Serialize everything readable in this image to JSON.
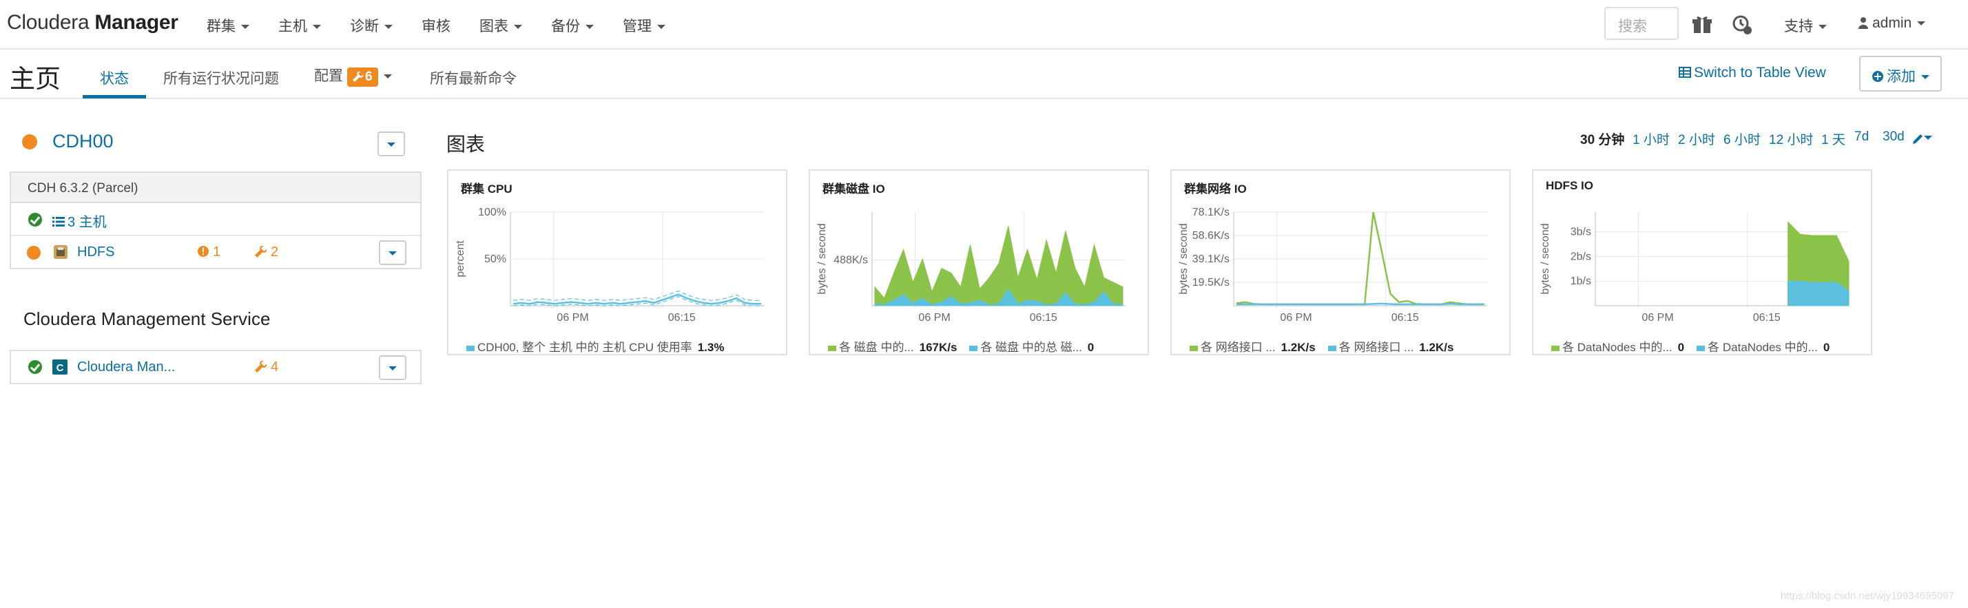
{
  "header": {
    "brand_light": "Cloudera ",
    "brand_bold": "Manager",
    "menu": [
      "群集",
      "主机",
      "诊断",
      "审核",
      "图表",
      "备份",
      "管理"
    ],
    "menu_has_caret": [
      true,
      true,
      true,
      false,
      true,
      true,
      true
    ],
    "search_placeholder": "搜索",
    "support_label": "支持",
    "user_label": "admin"
  },
  "subheader": {
    "page_title": "主页",
    "tabs": [
      "状态",
      "所有运行状况问题",
      "配置",
      "所有最新命令"
    ],
    "active_tab": 0,
    "config_badge": "6",
    "switch_view_label": "Switch to Table View",
    "add_label": "添加"
  },
  "cluster": {
    "name": "CDH00",
    "status_color": "#f0891f",
    "version": "CDH 6.3.2 (Parcel)",
    "hosts_label": "3 主机",
    "service_name": "HDFS",
    "service_alerts": "1",
    "service_config_issues": "2"
  },
  "cms": {
    "section_title": "Cloudera Management Service",
    "service_name": "Cloudera Man...",
    "config_issues": "4"
  },
  "charts_section": {
    "title": "图表",
    "time_ranges": [
      "30 分钟",
      "1 小时",
      "2 小时",
      "6 小时",
      "12 小时",
      "1 天",
      "7d",
      "30d"
    ],
    "active_range": 0
  },
  "chart_data": [
    {
      "type": "line",
      "title": "群集 CPU",
      "ylabel": "percent",
      "y_ticks": [
        "100%",
        "50%"
      ],
      "x_ticks": [
        "06 PM",
        "06:15"
      ],
      "ylim": [
        0,
        100
      ],
      "series": [
        {
          "name": "CDH00, 整个 主机 中的 主机 CPU 使用率",
          "color": "#5bc0de",
          "values": [
            2,
            3,
            2,
            4,
            3,
            2,
            3,
            4,
            3,
            2,
            3,
            2,
            3,
            2,
            3,
            4,
            5,
            3,
            6,
            9,
            12,
            8,
            5,
            3,
            2,
            3,
            5,
            8,
            3,
            2,
            2
          ]
        }
      ],
      "legend_values": [
        "1.3%"
      ]
    },
    {
      "type": "area",
      "title": "群集磁盘 IO",
      "ylabel": "bytes / second",
      "y_ticks": [
        "488K/s"
      ],
      "x_ticks": [
        "06 PM",
        "06:15"
      ],
      "ylim": [
        0,
        1000000
      ],
      "series": [
        {
          "name": "各 磁盘 中的...",
          "color": "#8bc34a",
          "values": [
            200000,
            80000,
            350000,
            600000,
            250000,
            500000,
            150000,
            400000,
            350000,
            200000,
            650000,
            180000,
            300000,
            450000,
            850000,
            300000,
            600000,
            280000,
            700000,
            350000,
            800000,
            400000,
            200000,
            650000,
            300000,
            250000,
            200000
          ]
        },
        {
          "name": "各 磁盘 中的总 磁...",
          "color": "#5bc0de",
          "values": [
            20000,
            10000,
            60000,
            120000,
            30000,
            80000,
            10000,
            40000,
            100000,
            20000,
            30000,
            60000,
            10000,
            20000,
            180000,
            20000,
            60000,
            50000,
            10000,
            20000,
            140000,
            20000,
            10000,
            40000,
            150000,
            20000,
            10000
          ]
        }
      ],
      "legend_values": [
        "167K/s",
        "0"
      ]
    },
    {
      "type": "line",
      "title": "群集网络 IO",
      "ylabel": "bytes / second",
      "y_ticks": [
        "78.1K/s",
        "58.6K/s",
        "39.1K/s",
        "19.5K/s"
      ],
      "x_ticks": [
        "06 PM",
        "06:15"
      ],
      "ylim": [
        0,
        78100
      ],
      "series": [
        {
          "name": "各 网络接口 ...",
          "color": "#8bc34a",
          "values": [
            2000,
            3000,
            1500,
            1200,
            1200,
            1200,
            1200,
            1200,
            1200,
            1200,
            1200,
            1200,
            1200,
            1200,
            1200,
            1200,
            78000,
            45000,
            10000,
            3000,
            4000,
            1500,
            1200,
            1200,
            1200,
            3000,
            2000,
            1200,
            1200,
            1200
          ]
        },
        {
          "name": "各 网络接口 ...",
          "color": "#5bc0de",
          "values": [
            1200,
            1200,
            1200,
            1200,
            1200,
            1200,
            1200,
            1200,
            1200,
            1200,
            1200,
            1200,
            1200,
            1200,
            1200,
            1200,
            1500,
            1800,
            1400,
            1200,
            1200,
            1200,
            1200,
            1200,
            1200,
            1600,
            1200,
            1200,
            1200,
            1200
          ]
        }
      ],
      "legend_values": [
        "1.2K/s",
        "1.2K/s"
      ]
    },
    {
      "type": "area",
      "title": "HDFS IO",
      "ylabel": "bytes / second",
      "y_ticks": [
        "3b/s",
        "2b/s",
        "1b/s"
      ],
      "x_ticks": [
        "06 PM",
        "06:15"
      ],
      "ylim": [
        0,
        3.8
      ],
      "series": [
        {
          "name": "各 DataNodes 中的...",
          "color": "#8bc34a",
          "values": [
            3.4,
            2.9,
            2.85,
            2.85,
            2.85,
            1.8
          ]
        },
        {
          "name": "各 DataNodes 中的...",
          "color": "#5bc0de",
          "values": [
            1.0,
            1.0,
            0.95,
            0.95,
            0.95,
            0.6
          ]
        }
      ],
      "legend_values": [
        "0",
        "0"
      ]
    }
  ],
  "watermark": "https://blog.csdn.net/wjy19934695097"
}
